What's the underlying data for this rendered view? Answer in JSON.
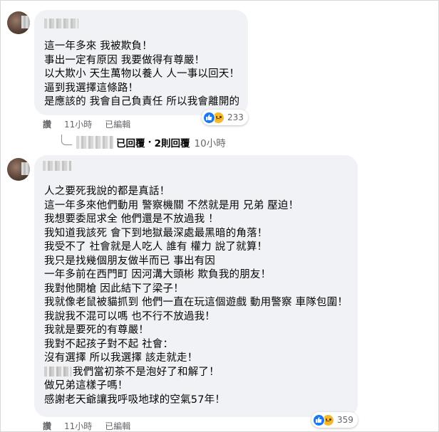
{
  "comments": [
    {
      "lines": [
        "這一年多來 我被欺負！",
        "事出一定有原因 我要做得有尊嚴！",
        "以大欺小 天生萬物以養人 人一事以回天！",
        "逼到我選擇這條路！",
        "是應該的 我會自己負責任 所以我會離開的"
      ],
      "reactions": {
        "icons": [
          "like-icon",
          "sad-icon"
        ],
        "count": "233"
      },
      "actions": {
        "reply": "讚",
        "time": "11小時",
        "edited": "已編輯"
      },
      "reply_summary": {
        "prefix": "已回覆",
        "sep": "·",
        "count": "2則回覆",
        "time": "10小時"
      }
    },
    {
      "lines": [
        "人之要死我說的都是真話！",
        "這一年多來他們動用 警察機關 不然就是用 兄弟 壓迫！",
        "我想要委屈求全 他們還是不放過我 ！",
        "我知道我該死 會下到地獄最深處最黑暗的角落！",
        "我受不了 社會就是人吃人 誰有 權力 說了就算！",
        "我只是找幾個朋友做半而已 事出有因",
        "一年多前在西門町 因河溝大頭彬 欺負我的朋友！",
        "我對他開槍 因此結下了梁子！",
        "我就像老鼠被貓抓到 他們一直在玩這個遊戲 動用警察 車隊包圍！",
        "我說我不混可以嗎 也不行不放過我！",
        "我就是要死的有尊嚴！",
        "我對不起孩子對不起 社會：",
        "沒有選擇 所以我選擇 該走就走！",
        "我們當初茶不是泡好了和解了！",
        "做兄弟這樣子嗎！",
        "感謝老天爺讓我呼吸地球的空氣57年！"
      ],
      "reactions": {
        "icons": [
          "like-icon",
          "sad-icon"
        ],
        "count": "359"
      },
      "actions": {
        "reply": "讚",
        "time": "11小時",
        "edited": "已編輯"
      }
    }
  ],
  "colors": {
    "bubble": "#f0f2f5",
    "meta": "#65676b",
    "like": "#1877f2",
    "sad": "#f7b928"
  }
}
